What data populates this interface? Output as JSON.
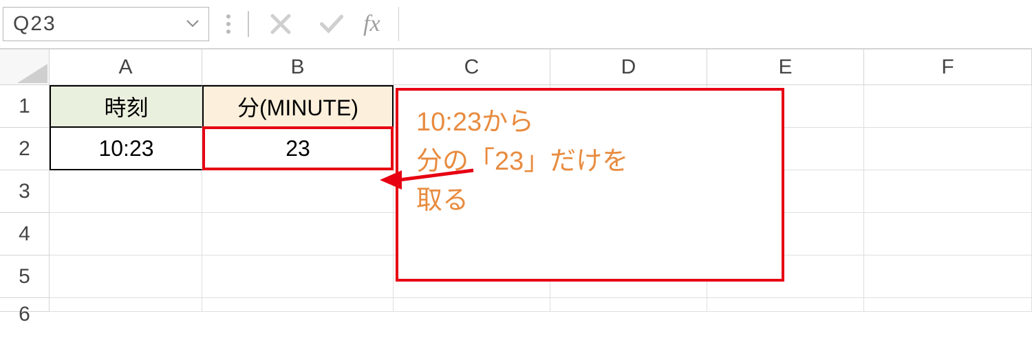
{
  "formula_bar": {
    "name_box_value": "Q23",
    "formula_value": "",
    "fx_label": "fx"
  },
  "columns": [
    "A",
    "B",
    "C",
    "D",
    "E",
    "F"
  ],
  "rows": [
    "1",
    "2",
    "3",
    "4",
    "5",
    "6"
  ],
  "cells": {
    "A1": "時刻",
    "B1": "分(MINUTE)",
    "A2": "10:23",
    "B2": "23"
  },
  "callout": {
    "line1": "10:23から",
    "line2": "分の「23」だけを",
    "line3": "取る"
  }
}
